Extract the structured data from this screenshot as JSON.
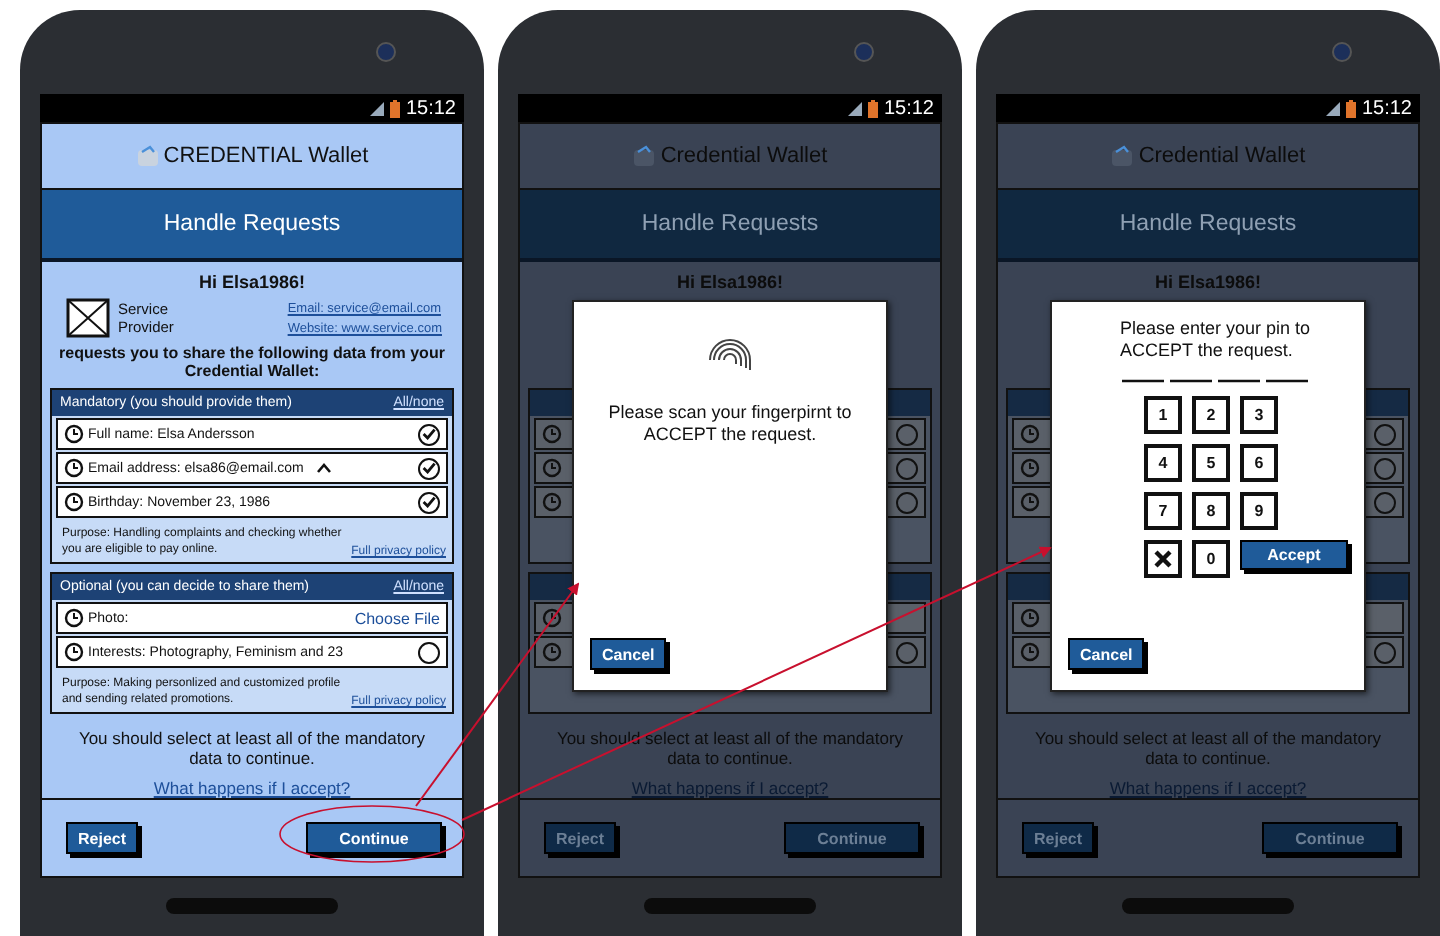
{
  "phones": [
    {
      "status_bar": {
        "time": "15:12"
      },
      "app": {
        "app_name": "CREDENTIAL Wallet",
        "title": "Handle Requests",
        "greeting": "Hi Elsa1986!",
        "provider": {
          "name": "Service Provider",
          "email": "Email: service@email.com",
          "website": "Website: www.service.com"
        },
        "intro": "requests you to share the following data from your Credential Wallet:",
        "sections": [
          {
            "heading": "Mandatory (you should provide them)",
            "toggle": "All/none",
            "items": [
              {
                "kind": "check",
                "label": "Full name: Elsa Andersson",
                "checked": true,
                "expandable": false
              },
              {
                "kind": "check",
                "label": "Email address: elsa86@email.com",
                "checked": true,
                "expandable": true
              },
              {
                "kind": "check",
                "label": "Birthday: November 23, 1986",
                "checked": true,
                "expandable": false
              }
            ],
            "purpose": "Purpose: Handling complaints and checking whether you are eligible to pay online.",
            "policy_link": "Full privacy policy"
          },
          {
            "heading": "Optional (you can decide to share them)",
            "toggle": "All/none",
            "items": [
              {
                "kind": "file",
                "label": "Photo:",
                "action": "Choose File",
                "expandable": false
              },
              {
                "kind": "check",
                "label": "Interests:",
                "value": "Photography, Feminism and 23",
                "checked": false,
                "expandable": false
              }
            ],
            "purpose": "Purpose: Making personlized and customized profile and sending related promotions.",
            "policy_link": "Full privacy policy"
          }
        ],
        "notice": "You should select at least all of the mandatory data to continue.",
        "help_link": "What happens if I accept?",
        "reject_button": "Reject",
        "continue_button": "Continue"
      },
      "dimmed": false
    },
    {
      "status_bar": {
        "time": "15:12"
      },
      "app": {
        "app_name": "Credential Wallet",
        "title": "Handle Requests",
        "greeting": "Hi Elsa1986!",
        "sections": [
          {
            "items": [
              {
                "kind": "check",
                "checked": false,
                "expandable": false
              },
              {
                "kind": "check",
                "checked": false,
                "expandable": false
              },
              {
                "kind": "check",
                "checked": false,
                "expandable": false
              }
            ]
          },
          {
            "items": [
              {
                "kind": "file",
                "expandable": false
              },
              {
                "kind": "check",
                "checked": false,
                "expandable": false
              }
            ]
          }
        ],
        "notice": "You should select at least all of the mandatory data to continue.",
        "help_link": "What happens if I accept?",
        "reject_button": "Reject",
        "continue_button": "Continue"
      },
      "dimmed": true,
      "dialog": {
        "kind": "fingerprint",
        "message": "Please scan your fingerpirnt to ACCEPT the request.",
        "cancel_button": "Cancel"
      }
    },
    {
      "status_bar": {
        "time": "15:12"
      },
      "app": {
        "app_name": "Credential Wallet",
        "title": "Handle Requests",
        "greeting": "Hi Elsa1986!",
        "sections": [
          {
            "items": [
              {
                "kind": "check",
                "checked": false,
                "expandable": false
              },
              {
                "kind": "check",
                "checked": false,
                "expandable": false
              },
              {
                "kind": "check",
                "checked": false,
                "expandable": false
              }
            ]
          },
          {
            "items": [
              {
                "kind": "file",
                "expandable": false
              },
              {
                "kind": "check",
                "checked": false,
                "expandable": false
              }
            ]
          }
        ],
        "notice": "You should select at least all of the mandatory data to continue.",
        "help_link": "What happens if I accept?",
        "reject_button": "Reject",
        "continue_button": "Continue"
      },
      "dimmed": true,
      "dialog": {
        "kind": "pin",
        "message": "Please enter your pin to ACCEPT the request.",
        "keys": [
          {
            "kind": "digit",
            "label": "1"
          },
          {
            "kind": "digit",
            "label": "2"
          },
          {
            "kind": "digit",
            "label": "3"
          },
          {
            "kind": "digit",
            "label": "4"
          },
          {
            "kind": "digit",
            "label": "5"
          },
          {
            "kind": "digit",
            "label": "6"
          },
          {
            "kind": "digit",
            "label": "7"
          },
          {
            "kind": "digit",
            "label": "8"
          },
          {
            "kind": "digit",
            "label": "9"
          },
          {
            "kind": "delete"
          },
          {
            "kind": "digit",
            "label": "0"
          }
        ],
        "accept_button": "Accept",
        "cancel_button": "Cancel"
      }
    }
  ]
}
